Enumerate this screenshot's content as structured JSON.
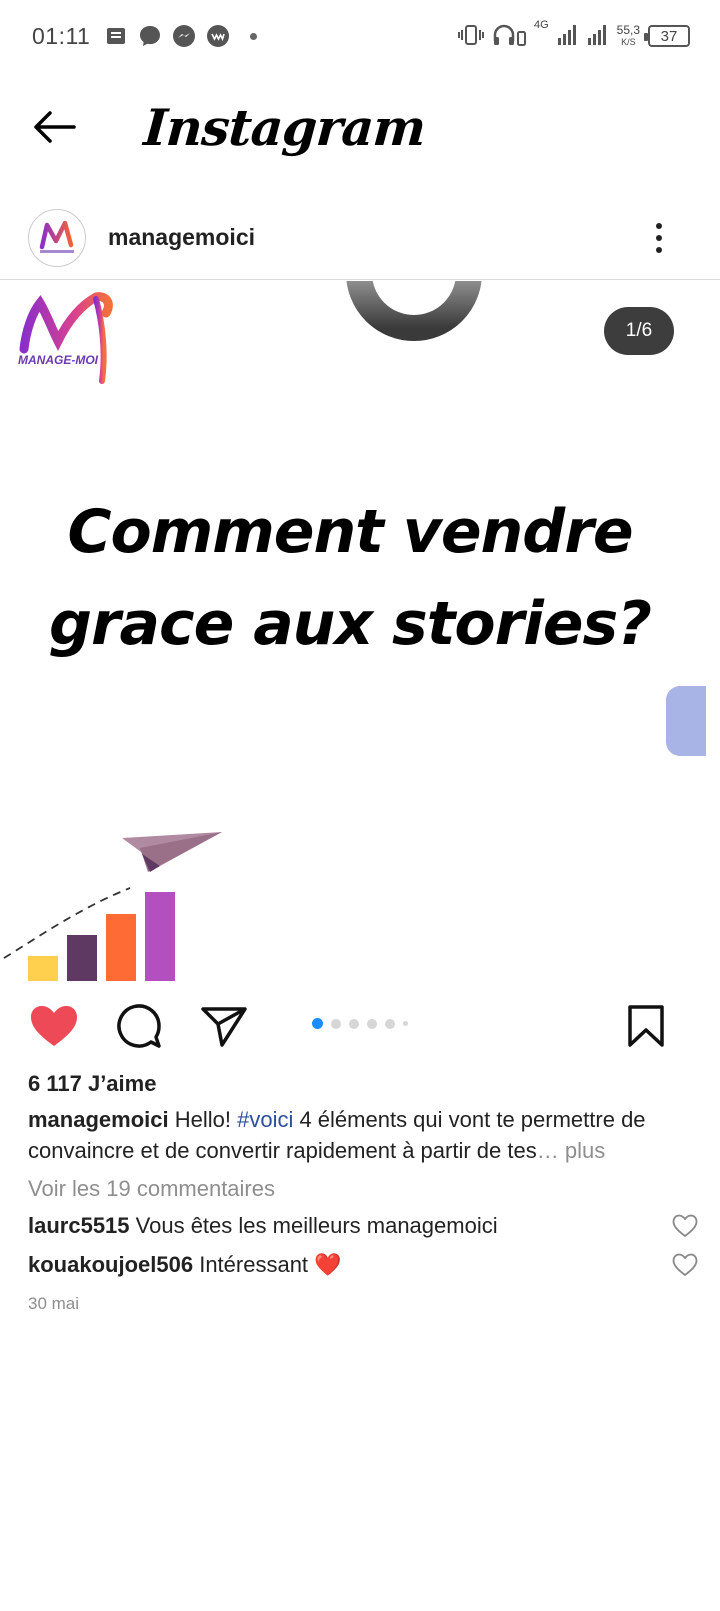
{
  "status_bar": {
    "time": "01:11",
    "network_speed_value": "55,3",
    "network_speed_unit": "K/S",
    "network_type": "4G",
    "battery_level": "37"
  },
  "header": {
    "app_name": "Instagram"
  },
  "post": {
    "username": "managemoici",
    "image_counter": "1/6",
    "media_title": "Comment vendre grace aux stories?",
    "brand_logo_text": "MANAGE-MOI",
    "carousel_dots": 6,
    "active_dot": 0,
    "likes_text": "6 117 J’aime",
    "caption_username": "managemoici",
    "caption_text_1": "Hello! ",
    "caption_hashtag": "#voici",
    "caption_text_2": " 4 éléments qui vont te permettre de convaincre et de convertir rapidement à partir de tes",
    "caption_more": "… plus",
    "view_comments": "Voir les 19 commentaires",
    "comments": [
      {
        "username": "laurc5515",
        "text": "Vous êtes les meilleurs managemoici"
      },
      {
        "username": "kouakoujoel506",
        "text": "Intéressant ❤️"
      }
    ],
    "date": "30 mai"
  },
  "colors": {
    "like_red": "#ed4956",
    "link_blue": "#2e4f9e",
    "dot_active": "#1a8cff",
    "bar_colors": [
      "#ffd04d",
      "#5e3a63",
      "#ff6b35",
      "#b34fbf"
    ]
  }
}
